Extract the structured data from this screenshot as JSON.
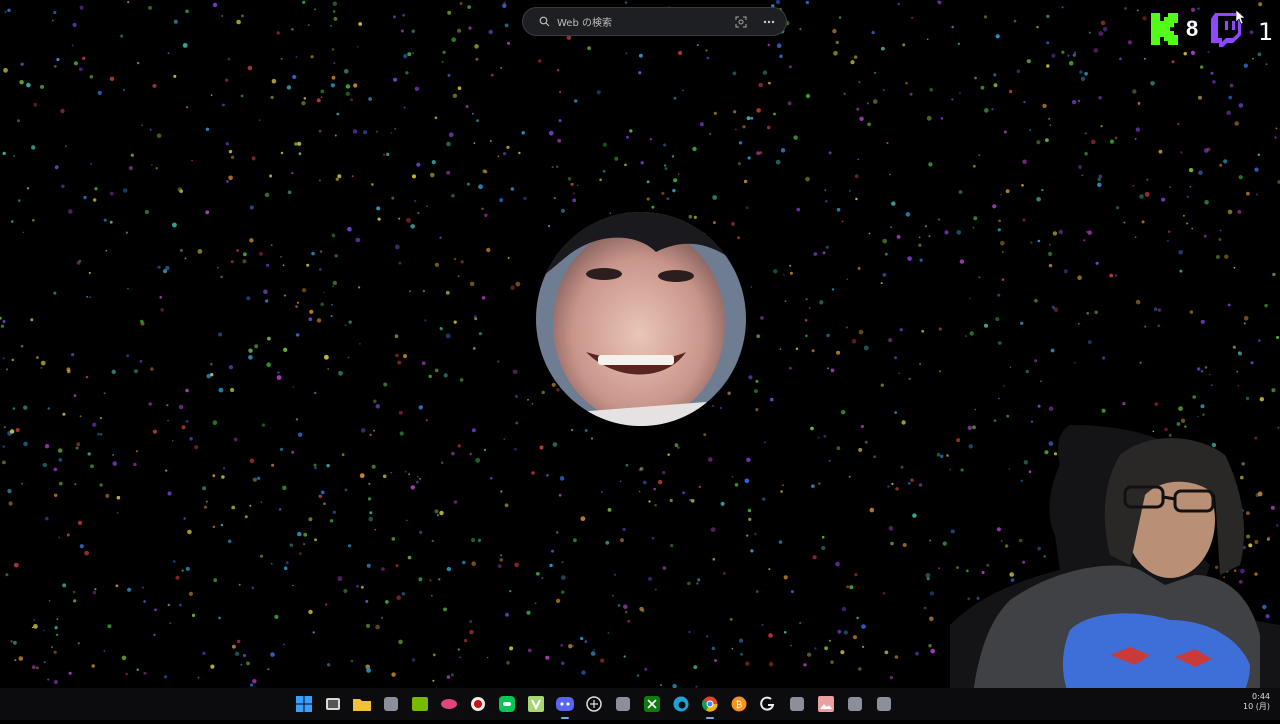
{
  "search": {
    "placeholder": "Web の検索"
  },
  "counters": {
    "kick": {
      "letter": "K",
      "count": "8",
      "color": "#53fc18"
    },
    "twitch": {
      "count": "1",
      "color": "#9146ff"
    }
  },
  "taskbar": {
    "icons": [
      "windows-start-icon",
      "task-view-icon",
      "file-explorer-icon",
      "app-icon",
      "nvidia-icon",
      "lips-app-icon",
      "record-icon",
      "line-icon",
      "v-app-icon",
      "discord-icon",
      "chatgpt-icon",
      "app-icon",
      "xbox-icon",
      "edge-icon",
      "chrome-icon",
      "bitcoin-app-icon",
      "logitech-icon",
      "app-icon",
      "image-app-icon",
      "app-icon",
      "app-icon"
    ],
    "clock": {
      "time": "0:44",
      "date": "10 (月)"
    }
  },
  "colors": {
    "background": "#000000",
    "taskbar": "#0c0c0e"
  }
}
